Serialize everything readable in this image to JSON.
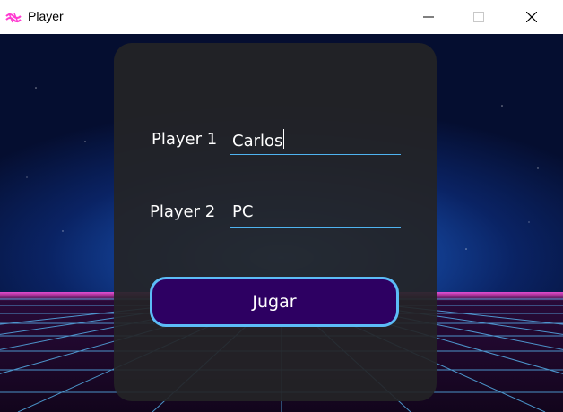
{
  "window": {
    "title": "Player",
    "icon": "game-logo-icon",
    "accent": "#ff3bd1"
  },
  "form": {
    "player1_label": "Player 1",
    "player1_value": "Carlos",
    "player2_label": "Player 2",
    "player2_value": "PC",
    "play_button": "Jugar"
  },
  "colors": {
    "panel": "#242426",
    "field_underline": "#4fb3f0",
    "button_fill": "#2d0062",
    "button_border": "#5cbcf7"
  }
}
